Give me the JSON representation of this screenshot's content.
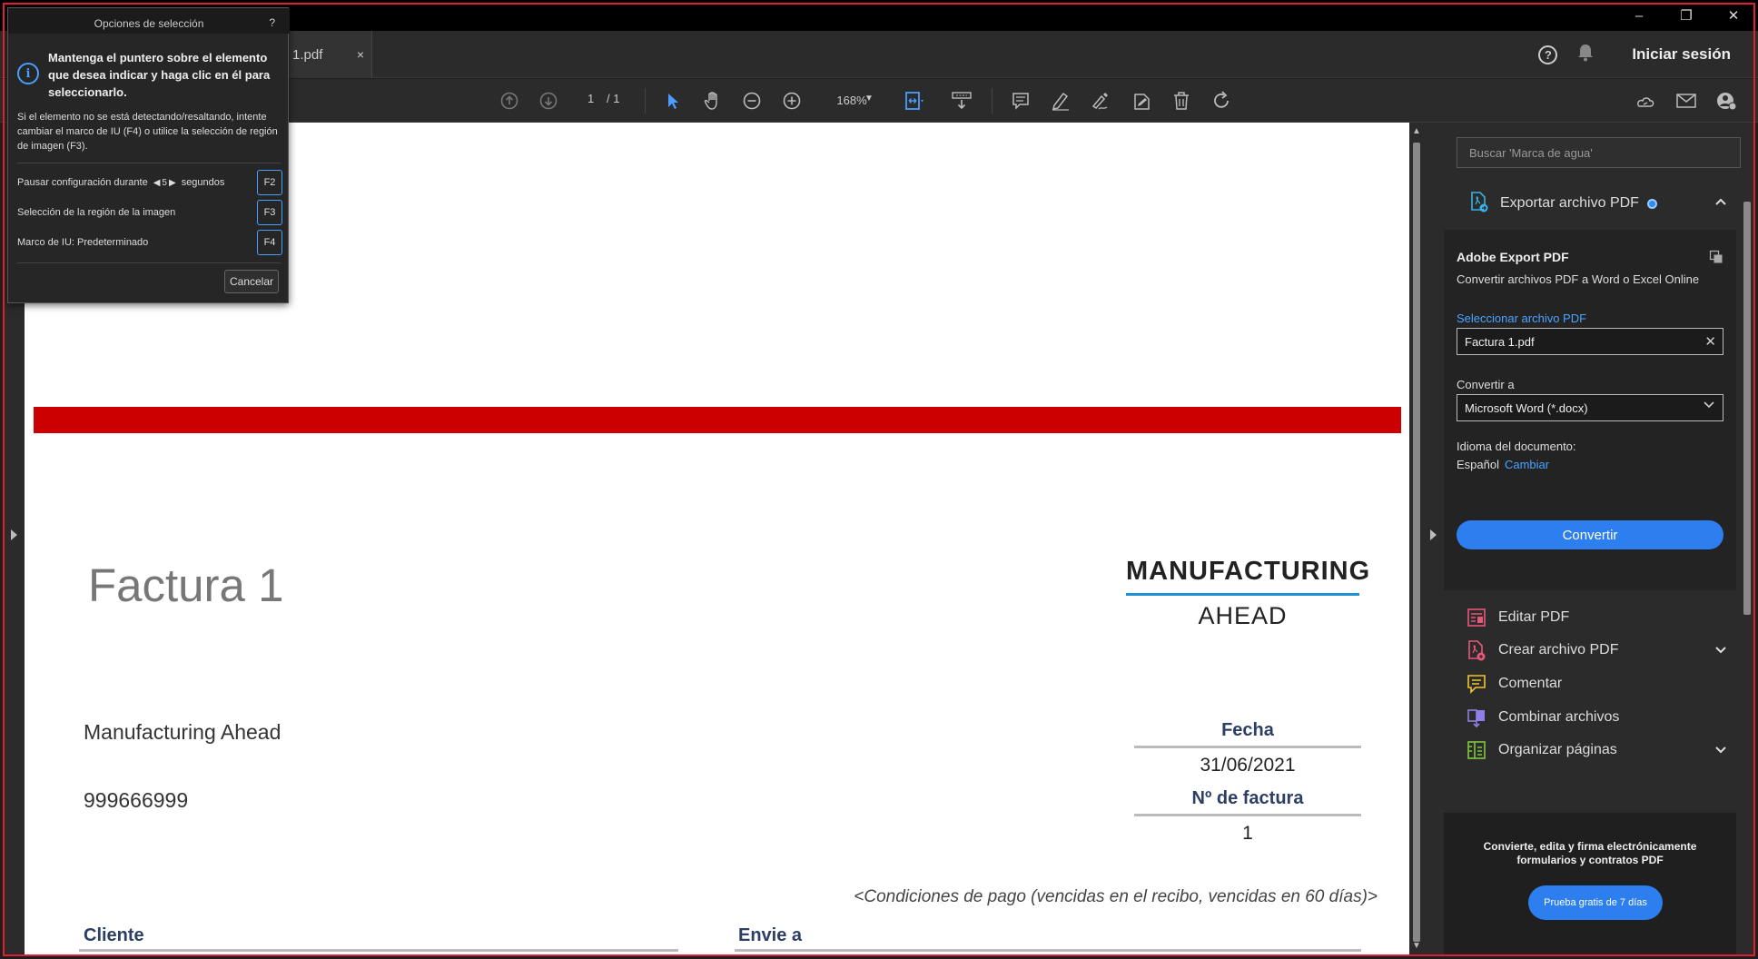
{
  "window": {
    "minimize": "–",
    "restore": "❐",
    "close": "✕"
  },
  "tab": {
    "label": "1.pdf",
    "close": "×"
  },
  "account": {
    "signin": "Iniciar sesión"
  },
  "toolbar": {
    "page_current": "1",
    "page_total": "/ 1",
    "zoom": "168%"
  },
  "document": {
    "title": "Factura 1",
    "logo_top": "MANUFACTURING",
    "logo_bottom": "AHEAD",
    "company": "Manufacturing Ahead",
    "phone": "999666999",
    "fecha_label": "Fecha",
    "fecha_value": "31/06/2021",
    "invoice_no_label": "Nº de factura",
    "invoice_no_value": "1",
    "payment_terms": "<Condiciones de pago (vencidas en el recibo, vencidas en 60 días)>",
    "client_label": "Cliente",
    "ship_label": "Envie a",
    "accent_red": "#cc0000"
  },
  "right_panel": {
    "search_placeholder": "Buscar 'Marca de agua'",
    "export_header": "Exportar archivo PDF",
    "export_title": "Adobe Export PDF",
    "export_sub": "Convertir archivos PDF a Word o Excel Online",
    "select_file_label": "Seleccionar archivo PDF",
    "file_value": "Factura 1.pdf",
    "convert_to_label": "Convertir a",
    "format_value": "Microsoft Word (*.docx)",
    "doc_lang_label": "Idioma del documento:",
    "doc_lang_value": "Español",
    "change_link": "Cambiar",
    "convert_button": "Convertir",
    "tools": [
      {
        "label": "Editar PDF"
      },
      {
        "label": "Crear archivo PDF"
      },
      {
        "label": "Comentar"
      },
      {
        "label": "Combinar archivos"
      },
      {
        "label": "Organizar páginas"
      }
    ],
    "promo_text": "Convierte, edita y firma electrónicamente formularios y contratos PDF",
    "promo_button": "Prueba gratis de 7 días",
    "accent_blue": "#2d7ff0"
  },
  "popup": {
    "title": "Opciones de selección",
    "help": "?",
    "info": "i",
    "bold_text": "Mantenga el puntero sobre el elemento que desea indicar y haga clic en él para seleccionarlo.",
    "small_text": "Si el elemento no se está detectando/resaltando, intente cambiar el marco de IU (F4) o utilice la selección de región de imagen (F3).",
    "pause_label": "Pausar configuración durante",
    "pause_value": "5",
    "pause_unit": "segundos",
    "pause_key": "F2",
    "region_label": "Selección de la región de la imagen",
    "region_key": "F3",
    "frame_label": "Marco de IU: Predeterminado",
    "frame_key": "F4",
    "cancel": "Cancelar"
  }
}
